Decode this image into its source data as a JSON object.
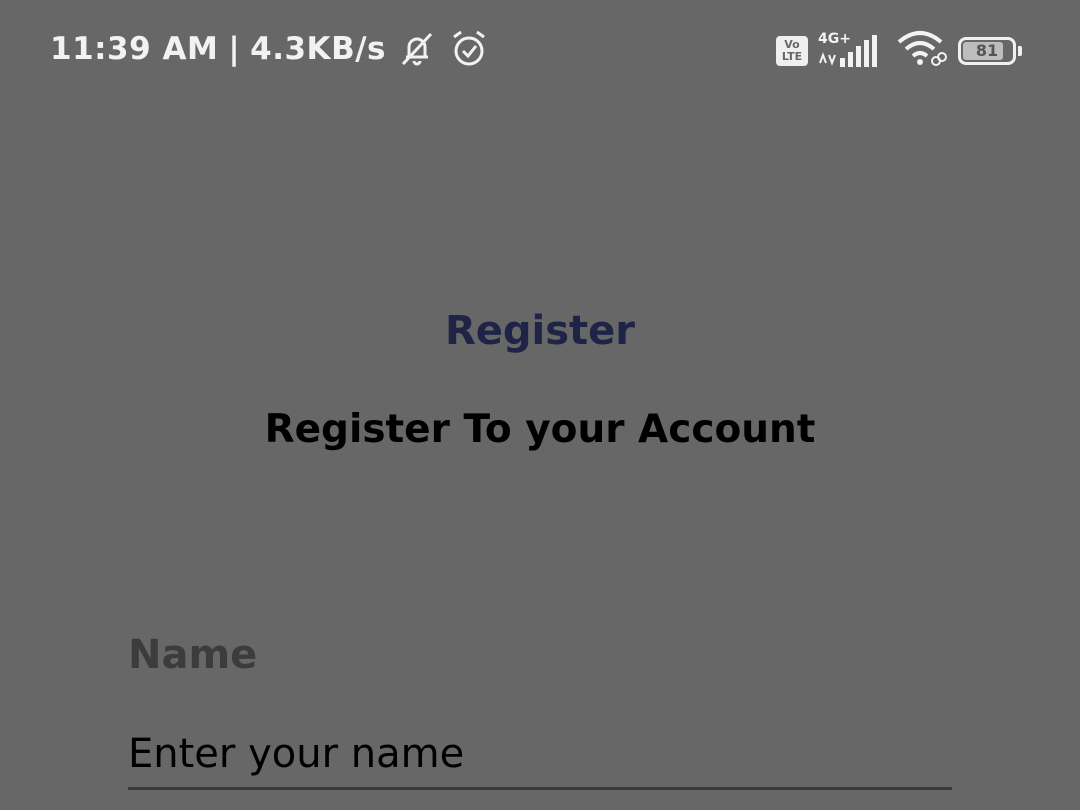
{
  "status_bar": {
    "time": "11:39 AM",
    "separator": "|",
    "net_speed": "4.3KB/s",
    "network_type": "4G+",
    "volte_top": "Vo",
    "volte_bottom": "LTE",
    "battery_level": "81",
    "icons": [
      "bell-off-icon",
      "alarm-icon",
      "volte-icon",
      "signal-icon",
      "wifi-icon",
      "battery-icon"
    ]
  },
  "header": {
    "title": "Register",
    "subtitle": "Register To your Account"
  },
  "form": {
    "name": {
      "label": "Name",
      "placeholder": "Enter your name"
    }
  },
  "colors": {
    "background": "#676767",
    "title": "#1f2447",
    "text": "#000000"
  }
}
